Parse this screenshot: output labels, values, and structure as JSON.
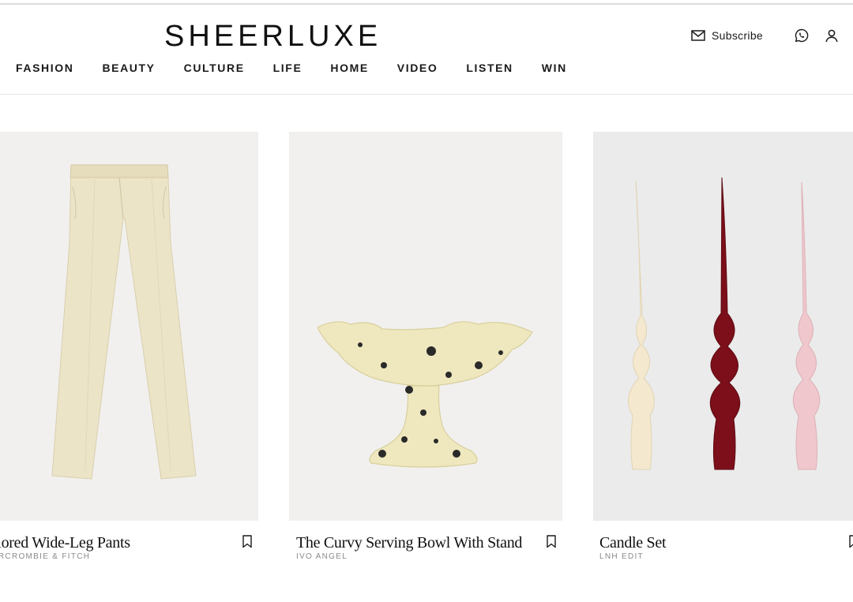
{
  "brand": {
    "logo": "SHEERLUXE"
  },
  "nav": [
    "FASHION",
    "BEAUTY",
    "CULTURE",
    "LIFE",
    "HOME",
    "VIDEO",
    "LISTEN",
    "WIN"
  ],
  "utility": {
    "subscribe_label": "Subscribe",
    "icons": [
      "mail-icon",
      "whatsapp-icon",
      "user-icon"
    ]
  },
  "products": [
    {
      "title": "Tailored Wide-Leg Pants",
      "brand": "ABERCROMBIE & FITCH",
      "image": "cream-wide-leg-pants"
    },
    {
      "title": "The Curvy Serving Bowl With Stand",
      "brand": "IVO ANGEL",
      "image": "speckled-footed-bowl"
    },
    {
      "title": "Candle Set",
      "brand": "LNH EDIT",
      "image": "twisted-taper-candles"
    }
  ],
  "colors": {
    "image_bg": "#f1f0ee",
    "text": "#111111",
    "muted": "#8a8a8a"
  }
}
